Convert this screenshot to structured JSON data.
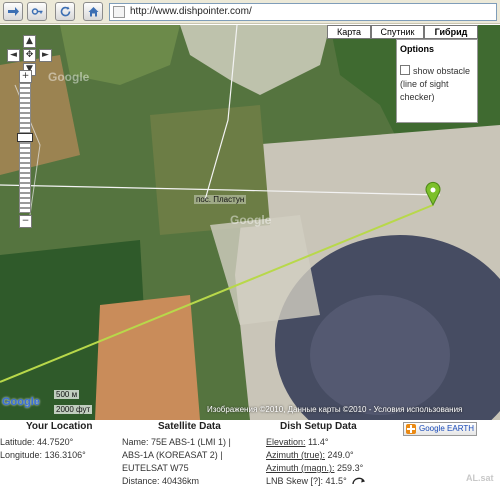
{
  "browser": {
    "url": "http://www.dishpointer.com/",
    "back_icon": "arrow-right-icon",
    "key_icon": "key-icon",
    "reload_icon": "reload-icon",
    "home_icon": "home-icon"
  },
  "map": {
    "zoom_controls": {
      "pan_up": "▲",
      "pan_left": "◄",
      "pan_center": "✥",
      "pan_right": "►",
      "pan_down": "▼",
      "zoom_in": "+",
      "zoom_out": "−"
    },
    "map_types": [
      "Карта",
      "Спутник",
      "Гибрид"
    ],
    "active_map_type": "Гибрид",
    "options": {
      "title": "Options",
      "show_obstacle_label": "show obstacle (line of sight checker)",
      "show_obstacle_checked": false
    },
    "town_label": "пос. Пластун",
    "watermark_1": "Google",
    "watermark_2": "Google",
    "logo_text": "Google",
    "scale_top": "500 м",
    "scale_bottom": "2000 фут",
    "copyright": "Изображения ©2010, Данные карты ©2010 - Условия использования",
    "colors": {
      "line_of_sight": "#b8d84a",
      "marker": "#7cc02a"
    }
  },
  "location": {
    "heading": "Your Location",
    "latitude_label": "Latitude:",
    "latitude_value": "44.7520°",
    "longitude_label": "Longitude:",
    "longitude_value": "136.3106°"
  },
  "satellite": {
    "heading": "Satellite Data",
    "name_line_1": "Name: 75E ABS-1 (LMI 1) |",
    "name_line_2": "ABS-1A (KOREASAT 2) |",
    "name_line_3": "EUTELSAT W75",
    "distance": "Distance: 40436km"
  },
  "dish": {
    "heading": "Dish Setup Data",
    "elevation_label": "Elevation:",
    "elevation_value": "11.4°",
    "azimuth_true_label": "Azimuth (true):",
    "azimuth_true_value": "249.0°",
    "azimuth_magn_label": "Azimuth (magn.):",
    "azimuth_magn_value": "259.3°",
    "lnb_label": "LNB Skew [?]:",
    "lnb_value": "41.5°",
    "lnb_icon": "rotate-arrow-icon"
  },
  "google_earth_button": "Google EARTH",
  "corner_mark": "AL.sat"
}
